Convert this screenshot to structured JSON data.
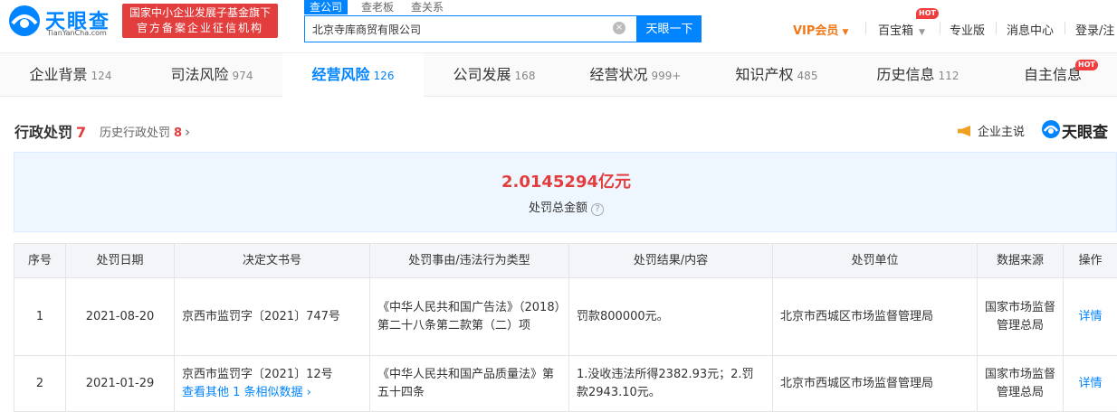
{
  "brand": {
    "name": "天眼查",
    "sub": "TianYanCha.com",
    "red_line1": "国家中小企业发展子基金旗下",
    "red_line2": "官方备案企业征信机构",
    "accent": "#0084ff",
    "red": "#e23e3e"
  },
  "search": {
    "tabs": [
      "查公司",
      "查老板",
      "查关系"
    ],
    "value": "北京寺库商贸有限公司",
    "clear_icon": "×",
    "button": "天眼一下"
  },
  "topnav": {
    "vip": "VIP会员",
    "treasure": "百宝箱",
    "hot": "HOT",
    "pro": "专业版",
    "messages": "消息中心",
    "login": "登录/注"
  },
  "tabs": [
    {
      "label": "企业背景",
      "count": "124"
    },
    {
      "label": "司法风险",
      "count": "974"
    },
    {
      "label": "经营风险",
      "count": "126"
    },
    {
      "label": "公司发展",
      "count": "168"
    },
    {
      "label": "经营状况",
      "count": "999+"
    },
    {
      "label": "知识产权",
      "count": "485"
    },
    {
      "label": "历史信息",
      "count": "112"
    },
    {
      "label": "自主信息",
      "count": ""
    }
  ],
  "section": {
    "title": "行政处罚",
    "count": "7",
    "history_label": "历史行政处罚",
    "history_count": "8",
    "chevron": "›",
    "promo": "企业主说",
    "logo_name": "天眼查"
  },
  "summary": {
    "total": "2.0145294亿元",
    "label": "处罚总金额",
    "help": "?"
  },
  "table": {
    "headers": [
      "序号",
      "处罚日期",
      "决定文书号",
      "处罚事由/违法行为类型",
      "处罚结果/内容",
      "处罚单位",
      "数据来源",
      "操作"
    ],
    "rows": [
      {
        "index": "1",
        "date": "2021-08-20",
        "doc": "京西市监罚字〔2021〕747号",
        "more": "",
        "reason": "《中华人民共和国广告法》（2018）第二十八条第二款第（二）项",
        "result": "罚款800000元。",
        "unit": "北京市西城区市场监督管理局",
        "source": "国家市场监督管理总局",
        "action": "详情"
      },
      {
        "index": "2",
        "date": "2021-01-29",
        "doc": "京西市监罚字〔2021〕12号",
        "more": "查看其他 1 条相似数据 ›",
        "reason": "《中华人民共和国产品质量法》第五十四条",
        "result": "1.没收违法所得2382.93元；2.罚款2943.10元。",
        "unit": "北京市西城区市场监督管理局",
        "source": "国家市场监督管理总局",
        "action": "详情"
      }
    ]
  }
}
